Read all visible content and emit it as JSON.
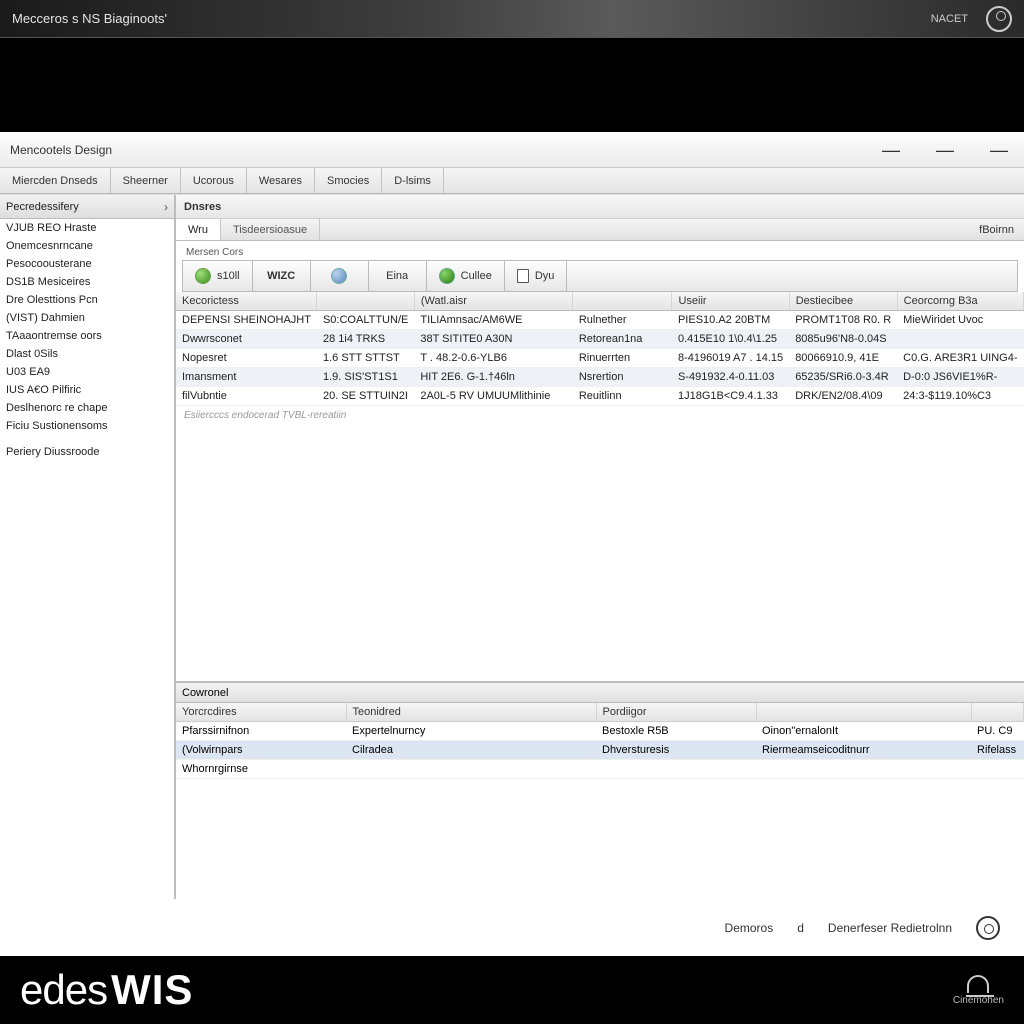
{
  "topbar": {
    "title": "Mecceros s NS Biaginoots'",
    "right_label": "NACET"
  },
  "window": {
    "title": "Mencootels Design",
    "menu": [
      "Miercden Dnseds",
      "Sheerner",
      "Ucorous",
      "Wesares",
      "Smocies",
      "D-lsims"
    ]
  },
  "sidebar": {
    "header": "Pecredessifery",
    "items": [
      "VJUB REO Hraste",
      "Onemcesnrncane",
      "Pesocoousterane",
      "DS1B Mesiceires",
      "Dre Olesttions Pcn",
      "(VIST) Dahmien",
      "TAaaontremse oors",
      "Dlast 0Sils",
      "U03 EA9",
      "IUS A€O Pilfiric",
      "Deslhenorc re chape",
      "Ficiu Sustionensoms",
      "Periery Diussroode"
    ]
  },
  "main": {
    "panel_title": "Dnsres",
    "subtabs": {
      "tabs": [
        "Wru",
        "Tisdeersioasue"
      ],
      "right": "fBoirnn"
    },
    "toolbar": {
      "label": "Mersen Cors",
      "buttons": [
        "s10ll",
        "WIZC",
        "",
        "Eina",
        "Cullee",
        "Dyu"
      ]
    },
    "grid": {
      "headers": [
        "Kecorictess",
        "",
        "(Watl.aisr",
        "",
        "Useiir",
        "Destiecibee",
        "Ceorcorng   B3a"
      ],
      "rows": [
        [
          "DEPENSI SHEINOHAJHT",
          "S0:COALTTUN/E",
          "TILIAmnsac/AM6WE",
          "Rulnether",
          "PIES10.A2 20BTM",
          "PROMT1T08 R0. R",
          "MieWiridet Uvoc"
        ],
        [
          "Dwwrsconet",
          "28 1i4 TRKS",
          "38T SITITE0 A30N",
          "Retorean1na",
          "0.415E10 1\\0.4\\1.25",
          "8085u96'N8-0.04S",
          ""
        ],
        [
          "Nopesret",
          "1.6 STT STTST",
          "T . 48.2-0.6-YLB6",
          "Rinuerrten",
          "8-4196019 A7 . 14.15",
          "80066910.9, 41E",
          "C0.G. ARE3R1 UING4-"
        ],
        [
          "Imansment",
          "1.9. SIS'ST1S1",
          "HIT 2E6. G-1.†46ln",
          "Nsrertion",
          "S-491932.4-0.11.03",
          "65235/SRi6.0-3.4R",
          "D-0:0 JS6VIE1%R-"
        ],
        [
          "filVubntie",
          "20. SE STTUIN2I",
          "2A0L-5 RV UMUUMlithinie",
          "Reuitlinn",
          "1J18G1B<C9.4.1.33",
          "DRK/EN2/08.4\\09",
          "24:3-$119.10%C3"
        ]
      ],
      "status": "Esiiercccs endocerad TVBL-rereatiin"
    },
    "lower": {
      "title": "Cowronel",
      "headers": [
        "Yorcrcdires",
        "Teonidred",
        "Pordiigor",
        ""
      ],
      "rows": [
        [
          "Pfarssirnifnon",
          "Expertelnurncy",
          "Bestoxle R5B",
          "Oinon\"ernalonIt",
          "PU. C9"
        ],
        [
          "(Volwirnpars",
          "Cilradea",
          "Dhversturesis",
          "Riermeamseicoditnurr",
          "Rifelass"
        ],
        [
          "Whornrgirnse",
          "",
          "",
          "",
          ""
        ]
      ]
    }
  },
  "footer_gray": {
    "items": [
      "Demoros",
      "d",
      "Denerfeser Redietrolnn"
    ]
  },
  "footer_black": {
    "logo_a": "edes",
    "logo_b": "WIS",
    "bell_label": "Cinemohen"
  }
}
